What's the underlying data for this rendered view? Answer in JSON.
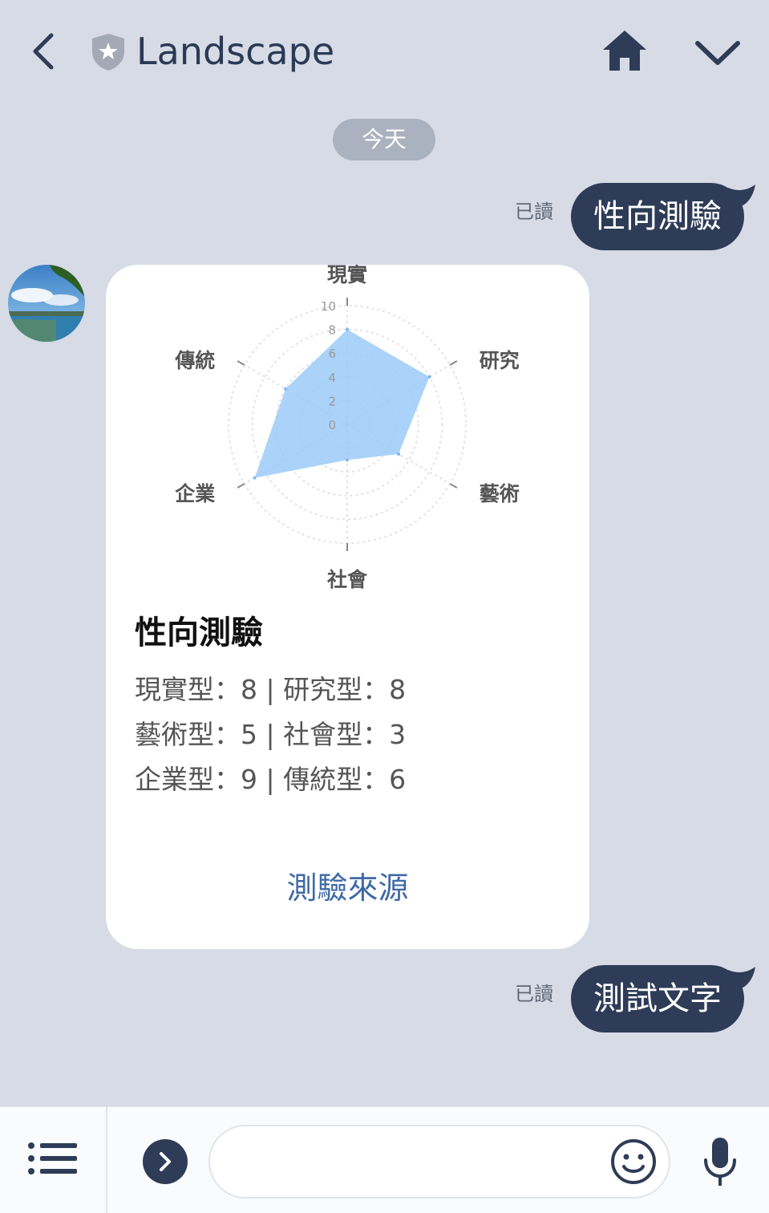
{
  "header": {
    "title": "Landscape"
  },
  "date_divider": "今天",
  "messages": [
    {
      "side": "right",
      "read": "已讀",
      "text": "性向測驗"
    },
    {
      "side": "right",
      "read": "已讀",
      "text": "測試文字"
    }
  ],
  "card": {
    "title": "性向測驗",
    "lines": [
      "現實型：8 | 研究型：8",
      "藝術型：5 | 社會型：3",
      "企業型：9 | 傳統型：6"
    ],
    "link": "測驗來源"
  },
  "chart_data": {
    "type": "radar",
    "categories": [
      "現實",
      "研究",
      "藝術",
      "社會",
      "企業",
      "傳統"
    ],
    "values": [
      8,
      8,
      5,
      3,
      9,
      6
    ],
    "ticks": [
      "0",
      "2",
      "4",
      "6",
      "8",
      "10"
    ],
    "range": [
      0,
      10
    ],
    "fill_color": "#9ccbf8"
  },
  "colors": {
    "accent": "#2e3c57",
    "background": "#d7dbe6",
    "link": "#3f6aa6"
  },
  "icons": [
    "back-arrow-icon",
    "shield-star-icon",
    "home-icon",
    "chevron-down-icon",
    "menu-list-icon",
    "chevron-right-icon",
    "emoji-icon",
    "microphone-icon"
  ]
}
